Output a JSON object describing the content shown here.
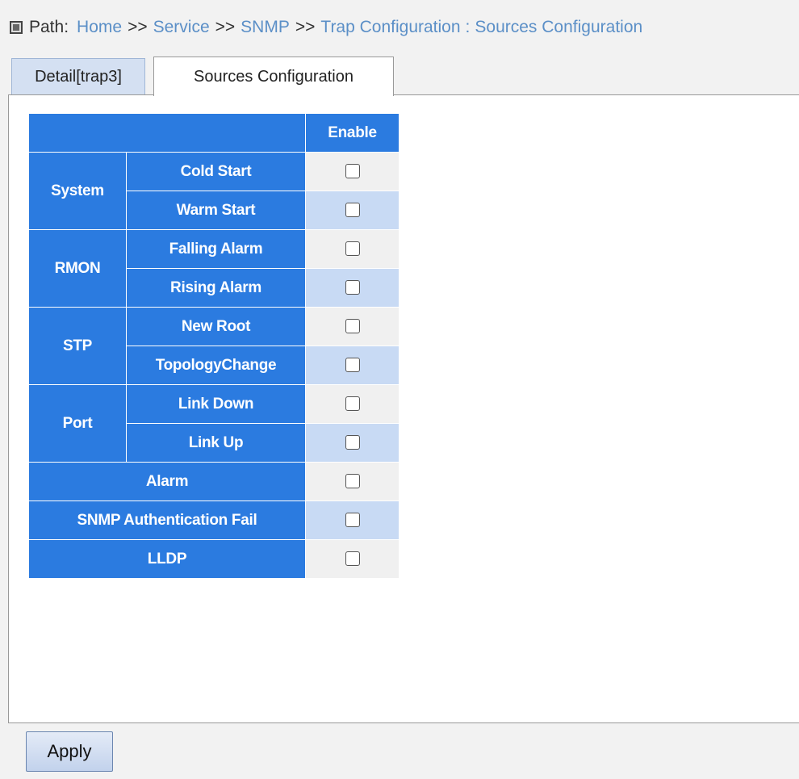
{
  "path": {
    "label": "Path:",
    "crumbs": [
      "Home",
      "Service",
      "SNMP",
      "Trap Configuration"
    ],
    "separator": ">>",
    "current": "Sources Configuration"
  },
  "tabs": [
    {
      "label": "Detail[trap3]"
    },
    {
      "label": "Sources Configuration"
    }
  ],
  "table": {
    "header_enable": "Enable",
    "groups": [
      {
        "name": "System",
        "items": [
          "Cold Start",
          "Warm Start"
        ]
      },
      {
        "name": "RMON",
        "items": [
          "Falling Alarm",
          "Rising Alarm"
        ]
      },
      {
        "name": "STP",
        "items": [
          "New Root",
          "TopologyChange"
        ]
      },
      {
        "name": "Port",
        "items": [
          "Link Down",
          "Link Up"
        ]
      }
    ],
    "singles": [
      "Alarm",
      "SNMP Authentication Fail",
      "LLDP"
    ]
  },
  "apply_label": "Apply",
  "colors": {
    "header_blue": "#2b7be0",
    "row_light": "#f0f0f0",
    "row_blue": "#c8daf4",
    "link_blue": "#5b8fc7"
  }
}
